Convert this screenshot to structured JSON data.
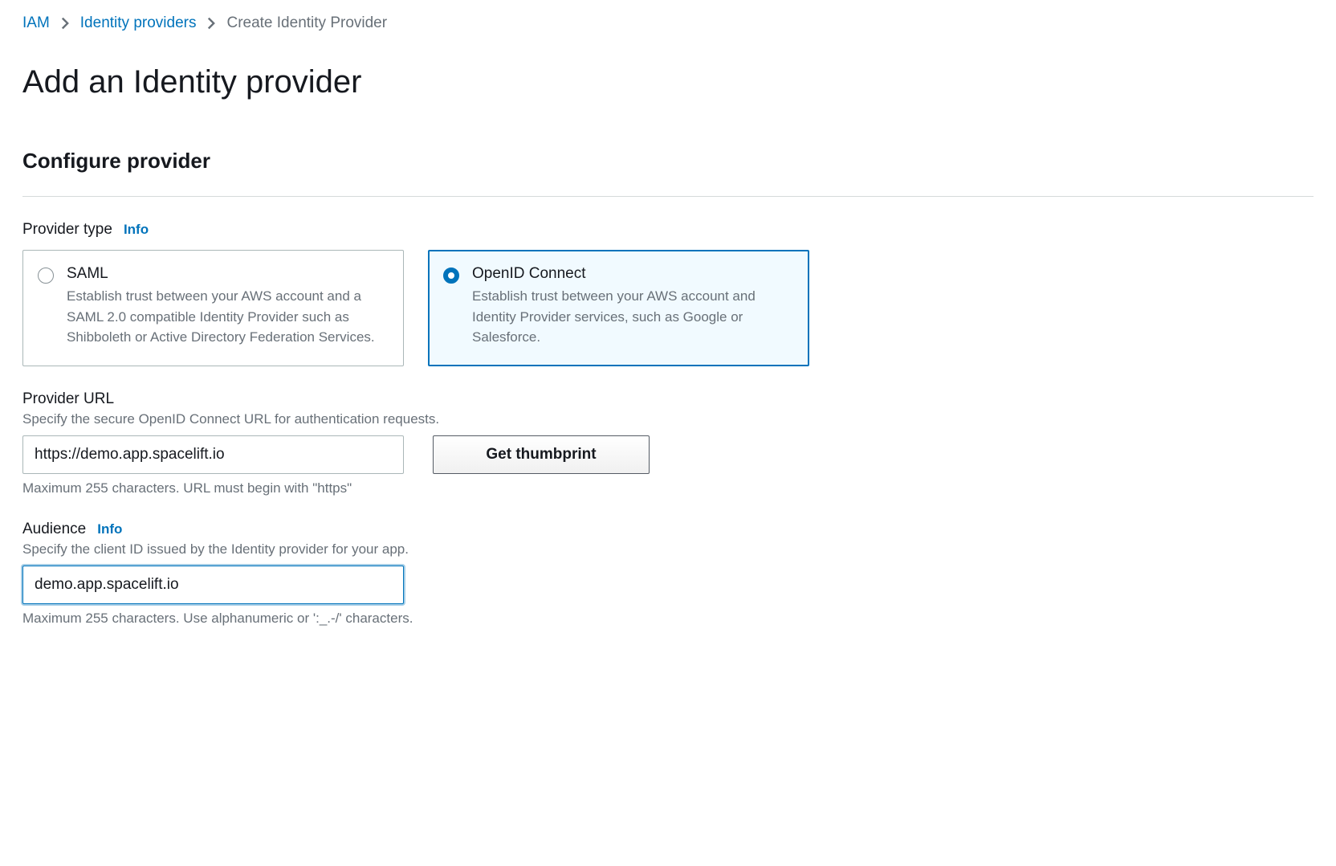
{
  "breadcrumb": {
    "iam": "IAM",
    "identity_providers": "Identity providers",
    "current": "Create Identity Provider"
  },
  "page": {
    "title": "Add an Identity provider"
  },
  "section": {
    "title": "Configure provider"
  },
  "provider_type": {
    "label": "Provider type",
    "info": "Info",
    "saml": {
      "title": "SAML",
      "desc": "Establish trust between your AWS account and a SAML 2.0 compatible Identity Provider such as Shibboleth or Active Directory Federation Services."
    },
    "oidc": {
      "title": "OpenID Connect",
      "desc": "Establish trust between your AWS account and Identity Provider services, such as Google or Salesforce."
    }
  },
  "provider_url": {
    "label": "Provider URL",
    "help": "Specify the secure OpenID Connect URL for authentication requests.",
    "value": "https://demo.app.spacelift.io",
    "button": "Get thumbprint",
    "hint": "Maximum 255 characters. URL must begin with \"https\""
  },
  "audience": {
    "label": "Audience",
    "info": "Info",
    "help": "Specify the client ID issued by the Identity provider for your app.",
    "value": "demo.app.spacelift.io",
    "hint": "Maximum 255 characters. Use alphanumeric or ':_.-/' characters."
  }
}
